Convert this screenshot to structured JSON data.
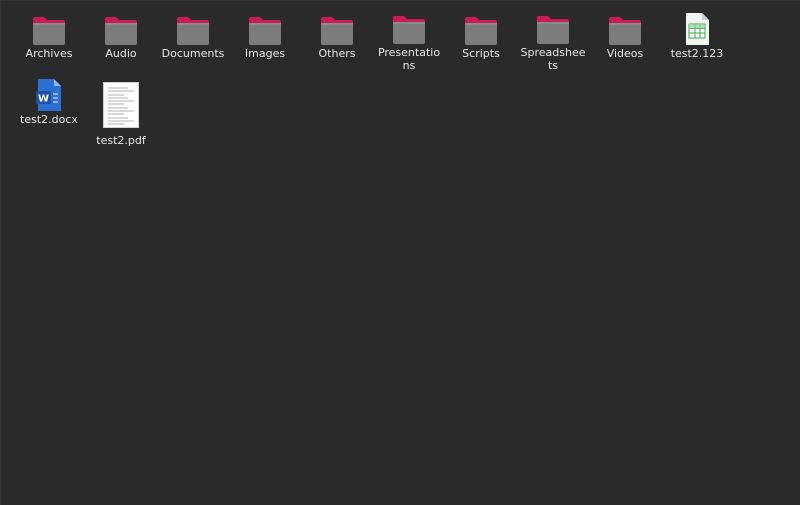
{
  "colors": {
    "background": "#2a2a2a",
    "folder_back": "#c81e55",
    "folder_front": "#7c7c7c",
    "label_text": "#e8e8e8"
  },
  "files": [
    {
      "label": "Archives",
      "kind": "folder",
      "icon": "folder-icon"
    },
    {
      "label": "Audio",
      "kind": "folder",
      "icon": "folder-icon"
    },
    {
      "label": "Documents",
      "kind": "folder",
      "icon": "folder-icon"
    },
    {
      "label": "Images",
      "kind": "folder",
      "icon": "folder-icon"
    },
    {
      "label": "Others",
      "kind": "folder",
      "icon": "folder-icon"
    },
    {
      "label": "Presentations",
      "kind": "folder",
      "icon": "folder-icon"
    },
    {
      "label": "Scripts",
      "kind": "folder",
      "icon": "folder-icon"
    },
    {
      "label": "Spreadsheets",
      "kind": "folder",
      "icon": "folder-icon"
    },
    {
      "label": "Videos",
      "kind": "folder",
      "icon": "folder-icon"
    },
    {
      "label": "test2.123",
      "kind": "spreadsheet",
      "icon": "spreadsheet-file-icon"
    },
    {
      "label": "test2.docx",
      "kind": "word",
      "icon": "word-document-icon"
    },
    {
      "label": "test2.pdf",
      "kind": "pdf",
      "icon": "pdf-thumbnail-icon"
    }
  ]
}
